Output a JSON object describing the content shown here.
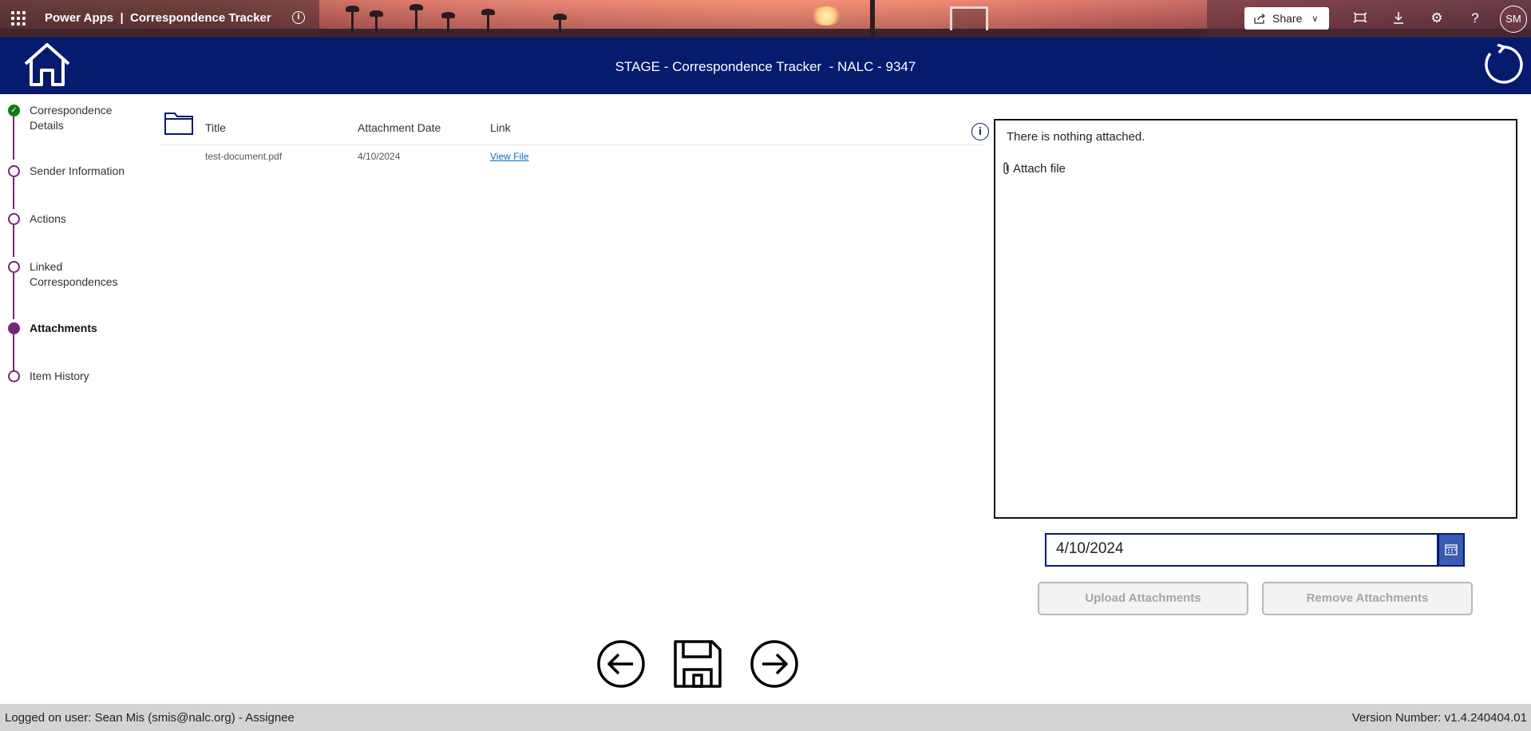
{
  "topbar": {
    "app_title": "Power Apps  |  Correspondence Tracker",
    "share_label": "Share",
    "avatar_initials": "SM",
    "icons": [
      "waffle-icon",
      "info-icon",
      "share-icon",
      "fit-to-window-icon",
      "download-icon",
      "settings-icon",
      "help-icon"
    ]
  },
  "header": {
    "title": "STAGE - Correspondence Tracker  - NALC - 9347",
    "color": "#061a6e"
  },
  "steps": [
    {
      "label_line1": "Correspondence",
      "label_line2": "Details",
      "state": "done"
    },
    {
      "label_line1": "Sender Information",
      "label_line2": "",
      "state": "pending"
    },
    {
      "label_line1": "Actions",
      "label_line2": "",
      "state": "pending"
    },
    {
      "label_line1": "Linked",
      "label_line2": "Correspondences",
      "state": "pending"
    },
    {
      "label_line1": "Attachments",
      "label_line2": "",
      "state": "active"
    },
    {
      "label_line1": "Item History",
      "label_line2": "",
      "state": "pending"
    }
  ],
  "attachments_table": {
    "columns": [
      "Title",
      "Attachment Date",
      "Link"
    ],
    "rows": [
      {
        "title": "test-document.pdf",
        "date": "4/10/2024",
        "link": "View File"
      }
    ]
  },
  "attach_box": {
    "empty_text": "There is nothing attached.",
    "attach_label": "Attach file"
  },
  "date_picker": {
    "value": "4/10/2024"
  },
  "buttons": {
    "upload": "Upload Attachments",
    "remove": "Remove Attachments"
  },
  "footer": {
    "user_text": "Logged on user: Sean Mis (smis@nalc.org) - Assignee",
    "version_text": "Version Number: v1.4.240404.01"
  },
  "colors": {
    "accent_purple": "#742774",
    "done_green": "#107c10",
    "navy": "#061a6e"
  }
}
